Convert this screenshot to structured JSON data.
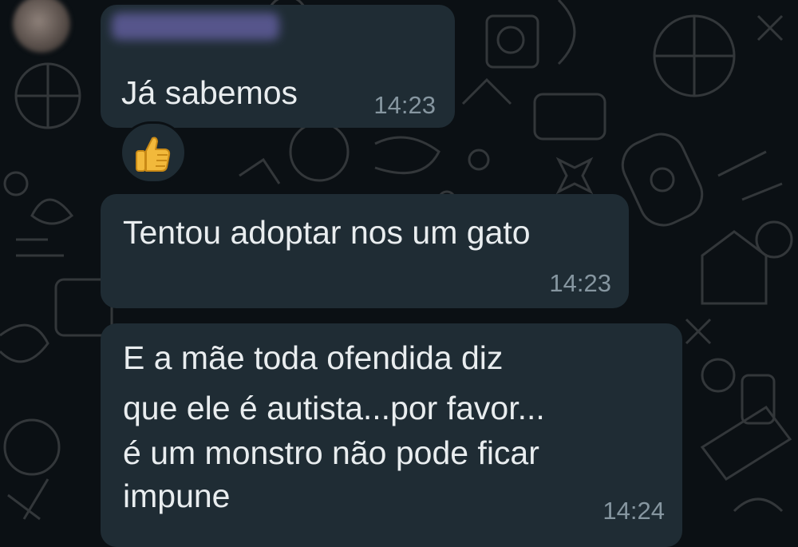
{
  "chat": {
    "messages": [
      {
        "text": "Já sabemos",
        "time": "14:23"
      },
      {
        "text": "Tentou adoptar nos um gato",
        "time": "14:23"
      },
      {
        "lines": [
          "E a mãe toda ofendida diz",
          "que ele é autista...por favor...",
          "é um monstro não pode ficar",
          "impune"
        ],
        "time": "14:24"
      }
    ],
    "reaction": {
      "icon": "thumbs-up-icon"
    }
  },
  "colors": {
    "background": "#0b1014",
    "bubble": "#1f2c34",
    "text": "#e9edef",
    "timestamp": "#8696a0"
  }
}
